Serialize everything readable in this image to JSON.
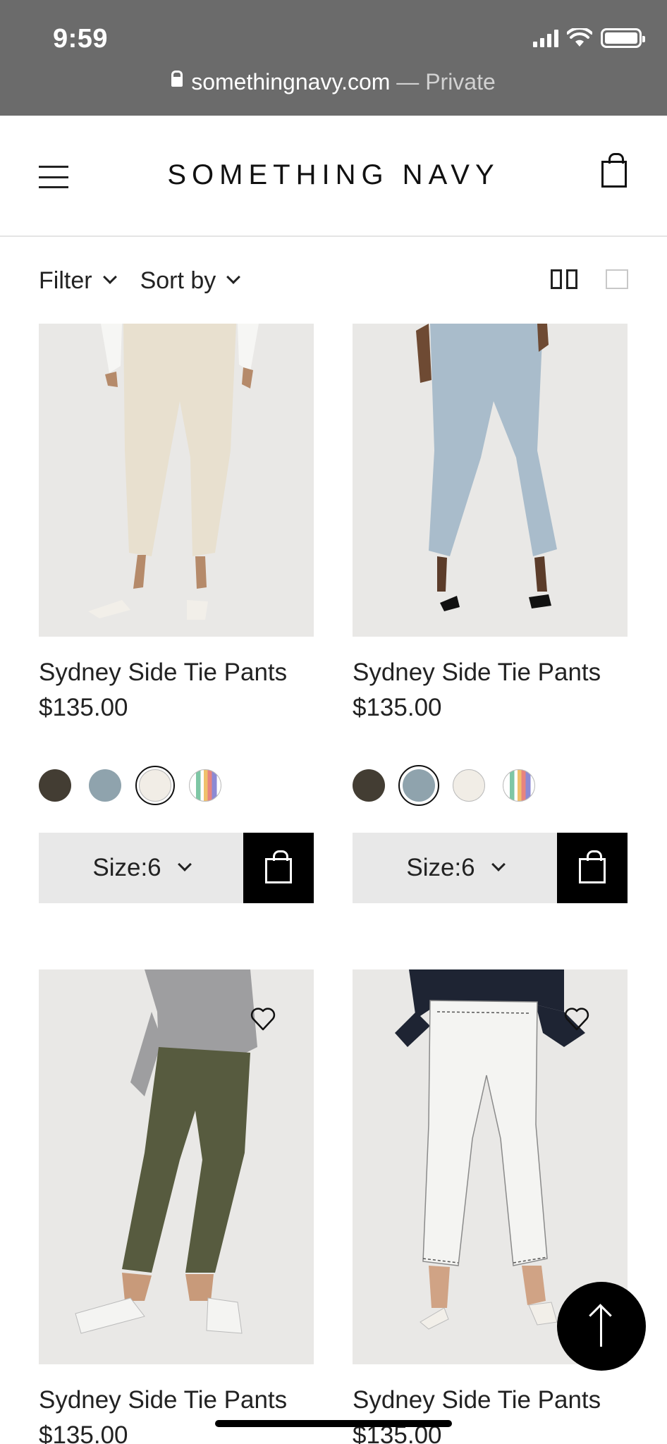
{
  "status_bar": {
    "time": "9:59"
  },
  "browser": {
    "domain": "somethingnavy.com",
    "separator": " — ",
    "mode": "Private"
  },
  "header": {
    "logo": "SOMETHING NAVY",
    "menu_icon": "hamburger-menu-icon",
    "cart_icon": "shopping-bag-icon"
  },
  "toolbar": {
    "filter_label": "Filter",
    "sort_label": "Sort by"
  },
  "products": [
    {
      "name": "Sydney Side Tie Pants",
      "price": "$135.00",
      "pant_color": "#e8e0cf",
      "swatches": [
        "#433d33",
        "#8fa3ad",
        "#f1ede6",
        "stripe"
      ],
      "selected_swatch": 2,
      "size_label": "Size:6"
    },
    {
      "name": "Sydney Side Tie Pants",
      "price": "$135.00",
      "pant_color": "#a9bccb",
      "swatches": [
        "#433d33",
        "#8fa3ad",
        "#f1ede6",
        "stripe"
      ],
      "selected_swatch": 1,
      "size_label": "Size:6"
    },
    {
      "name": "Sydney Side Tie Pants",
      "price": "$135.00",
      "pant_color": "#575b3f"
    },
    {
      "name": "Sydney Side Tie Pants",
      "price": "$135.00",
      "pant_color": "#f4f4f2"
    }
  ],
  "colors": {
    "chrome_bg": "#6b6b6b",
    "image_bg": "#e9e8e6",
    "size_bg": "#e8e8e8",
    "accent": "#000000"
  }
}
